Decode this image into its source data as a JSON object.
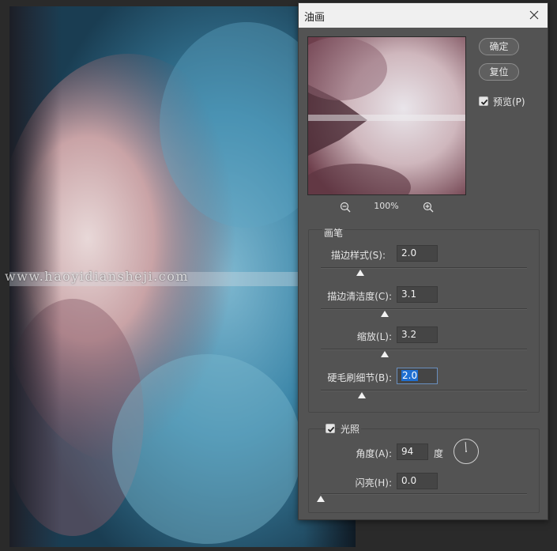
{
  "watermark": "www.haoyidiansheji.com",
  "dialog": {
    "title": "油画",
    "ok_label": "确定",
    "reset_label": "复位",
    "preview_label": "预览(P)",
    "preview_checked": true,
    "zoom_level": "100%"
  },
  "brush": {
    "group_title": "画笔",
    "controls": [
      {
        "label": "描边样式(S):",
        "value": "2.0",
        "slider_fraction": 0.19
      },
      {
        "label": "描边清洁度(C):",
        "value": "3.1",
        "slider_fraction": 0.31
      },
      {
        "label": "缩放(L):",
        "value": "3.2",
        "slider_fraction": 0.31
      },
      {
        "label": "硬毛刷细节(B):",
        "value": "2.0",
        "slider_fraction": 0.2,
        "selected": true
      }
    ]
  },
  "lighting": {
    "group_title": "光照",
    "enabled": true,
    "angle_label": "角度(A):",
    "angle_value": "94",
    "angle_unit": "度",
    "shine_label": "闪亮(H):",
    "shine_value": "0.0",
    "shine_slider_fraction": 0.0
  },
  "colors": {
    "dialog_bg": "#535353",
    "accent_selection": "#1f6fd1",
    "art_teal": "#3f8aa8",
    "art_pink": "#b98b8d"
  }
}
